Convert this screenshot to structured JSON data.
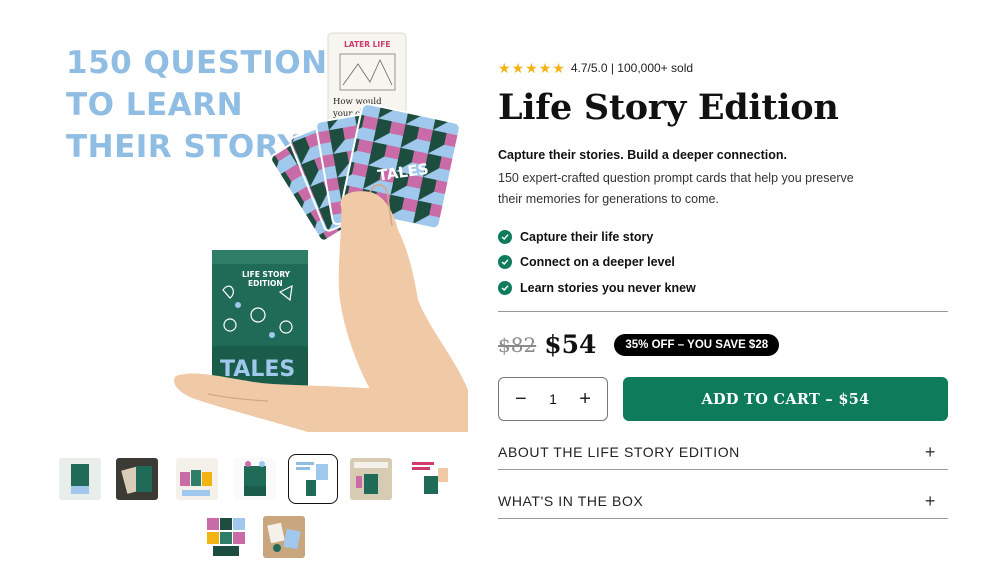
{
  "hero": {
    "headline": [
      "150 QUESTIONS",
      "TO LEARN",
      "THEIR STORY"
    ],
    "card_top_label": "LATER LIFE",
    "card_top_text": [
      "How would",
      "your closest"
    ],
    "deck_brand": "TALES",
    "box_title": [
      "LIFE STORY",
      "EDITION"
    ],
    "box_brand": "TALES"
  },
  "colors": {
    "accent": "#0e7c5a",
    "star": "#f3b313",
    "headline_blue": "#8fbde3",
    "pink": "#c96ba6",
    "lightblue": "#9fc8ec"
  },
  "rating": {
    "score": "4.7/5.0 | 100,000+ sold",
    "stars": 5
  },
  "product": {
    "title": "Life Story Edition",
    "tagline": "Capture their stories. Build a deeper connection.",
    "description": "150 expert-crafted question prompt cards that help you preserve their memories for generations to come."
  },
  "bullets": [
    "Capture their life story",
    "Connect on a deeper level",
    "Learn stories you never knew"
  ],
  "price": {
    "old": "$82",
    "new": "$54",
    "badge": "35% OFF – YOU SAVE $28"
  },
  "cart": {
    "minus": "−",
    "qty": "1",
    "plus": "+",
    "add_label": "ADD TO CART – $54"
  },
  "accordions": [
    {
      "label": "ABOUT THE LIFE STORY EDITION",
      "icon": "+"
    },
    {
      "label": "WHAT'S IN THE BOX",
      "icon": "+"
    }
  ],
  "thumbnails": [
    "box-front",
    "hands-cards",
    "card-spread",
    "box-with-cards",
    "hand-fan-cards",
    "promo-tiles",
    "pink-headline",
    "pattern-cards",
    "table-cards"
  ],
  "active_thumbnail": 4
}
